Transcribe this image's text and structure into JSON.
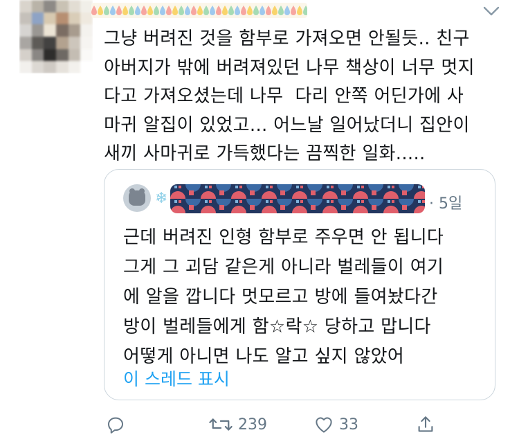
{
  "tweet": {
    "text": "그냥 버려진 것을 함부로 가져오면 안될듯.. 친구\n아버지가 밖에 버려져있던 나무 책상이 너무 멋지\n다고 가져오셨는데 나무  다리 안쪽 어딘가에 사\n마귀 알집이 있었고... 어느날 일어났더니 집안이\n새끼 사마귀로 가득했다는 끔찍한 일화....."
  },
  "quote": {
    "time": "· 5일",
    "text": "근데 버려진 인형 함부로 주우면 안 됩니다\n그게 그 괴담 같은게 아니라 벌레들이 여기\n에 알을 깝니다 멋모르고 방에 들여놨다간\n방이 벌레들에게 함☆락☆ 당하고 맙니다\n어떻게 아니면 나도 알고 싶지 않았어",
    "show_thread": "이 스레드 표시"
  },
  "actions": {
    "retweet_count": "239",
    "like_count": "33"
  },
  "colors": {
    "accent": "#1da1f2",
    "muted": "#657786",
    "border": "#ccd6dd"
  },
  "icons": {
    "caret": "chevron-down-icon",
    "reply": "reply-icon",
    "retweet": "retweet-icon",
    "like": "heart-icon",
    "share": "share-icon"
  }
}
